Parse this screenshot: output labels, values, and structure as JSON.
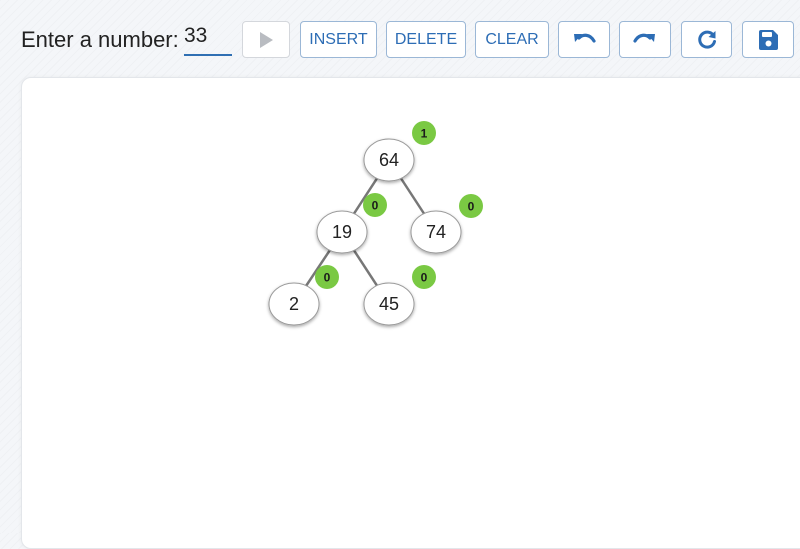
{
  "toolbar": {
    "prompt_label": "Enter a number:",
    "number_value": "33",
    "insert_label": "INSERT",
    "delete_label": "DELETE",
    "clear_label": "CLEAR"
  },
  "icons": {
    "play": "play-icon",
    "undo": "undo-icon",
    "redo": "redo-icon",
    "refresh": "refresh-icon",
    "save": "save-icon"
  },
  "colors": {
    "accent": "#2d6db5",
    "badge": "#7ac943",
    "edge": "#777777"
  },
  "tree": {
    "nodes": [
      {
        "id": "n64",
        "value": "64",
        "balance": "1"
      },
      {
        "id": "n19",
        "value": "19",
        "balance": "0"
      },
      {
        "id": "n74",
        "value": "74",
        "balance": "0"
      },
      {
        "id": "n2",
        "value": "2",
        "balance": "0"
      },
      {
        "id": "n45",
        "value": "45",
        "balance": "0"
      }
    ],
    "edges": [
      {
        "from": "n64",
        "to": "n19"
      },
      {
        "from": "n64",
        "to": "n74"
      },
      {
        "from": "n19",
        "to": "n2"
      },
      {
        "from": "n19",
        "to": "n45"
      }
    ]
  }
}
